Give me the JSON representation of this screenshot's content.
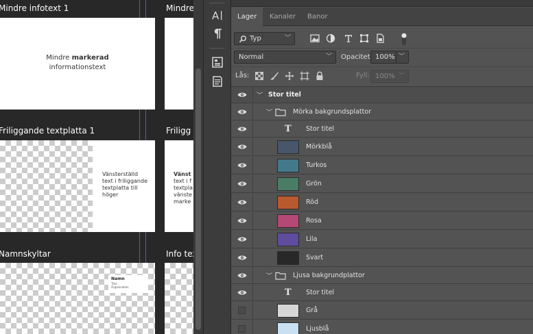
{
  "canvas": {
    "artboards": [
      {
        "title": "Mindre infotext 1"
      },
      {
        "title": "Mindre"
      },
      {
        "title": "Friliggande textplatta 1"
      },
      {
        "title": "Friligg"
      },
      {
        "title": "Namnskyltar"
      },
      {
        "title": "Info tex"
      }
    ],
    "infotext": {
      "normal": "Mindre ",
      "bold": "markerad",
      "line2": "informationstext"
    },
    "platta_left": {
      "line1": "Vänsterställd",
      "line2": "text i friliggande",
      "line3": "textplatta till",
      "line4": "höger"
    },
    "platta_right": {
      "bold": "Vänst",
      "line2": "text i f",
      "line3": "textpla",
      "line4": "vänste",
      "line5": "marke"
    },
    "namnskylt": {
      "name": "Namn",
      "title": "Titel",
      "org": "Organisation"
    }
  },
  "panel": {
    "tabs": [
      "Lager",
      "Kanaler",
      "Banor"
    ],
    "active_tab": "Lager",
    "filter": {
      "label": "Typ",
      "icons": [
        "image-filter-icon",
        "adjustment-filter-icon",
        "type-filter-icon",
        "shape-filter-icon",
        "smart-object-filter-icon"
      ]
    },
    "blend_mode": "Normal",
    "opacity_label": "Opacitet:",
    "opacity_value": "100%",
    "lock_label": "Lås:",
    "fill_label": "Fyll:",
    "fill_value": "100%"
  },
  "layers": [
    {
      "name": "Stor titel",
      "kind": "group-top",
      "visible": true
    },
    {
      "name": "Mörka bakgrundsplattor",
      "kind": "folder",
      "visible": true
    },
    {
      "name": "Stor titel",
      "kind": "text",
      "visible": true
    },
    {
      "name": "Mörkblå",
      "kind": "swatch",
      "color": "#47566a",
      "visible": true
    },
    {
      "name": "Turkos",
      "kind": "swatch",
      "color": "#43798a",
      "visible": true
    },
    {
      "name": "Grön",
      "kind": "swatch",
      "color": "#4a7e64",
      "visible": true
    },
    {
      "name": "Röd",
      "kind": "swatch",
      "color": "#b85a2e",
      "visible": true
    },
    {
      "name": "Rosa",
      "kind": "swatch",
      "color": "#b54874",
      "visible": true
    },
    {
      "name": "Lila",
      "kind": "swatch",
      "color": "#5f4c9e",
      "visible": true
    },
    {
      "name": "Svart",
      "kind": "swatch",
      "color": "#282828",
      "visible": true
    },
    {
      "name": "Ljusa bakgrundplattor",
      "kind": "folder",
      "visible": true
    },
    {
      "name": "Stor titel",
      "kind": "text",
      "visible": true
    },
    {
      "name": "Grå",
      "kind": "swatch",
      "color": "#d6d6d6",
      "visible": false
    },
    {
      "name": "Ljusblå",
      "kind": "swatch",
      "color": "#c8e0f2",
      "visible": false
    }
  ]
}
